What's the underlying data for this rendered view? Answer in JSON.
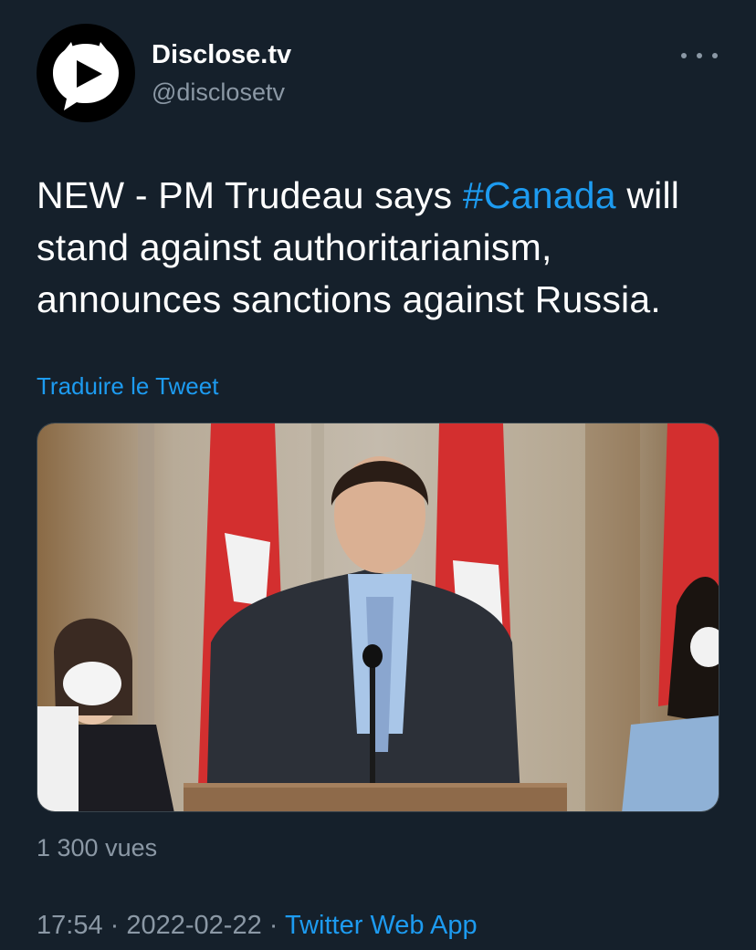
{
  "author": {
    "name": "Disclose.tv",
    "handle": "@disclosetv",
    "avatar_icon": "play-logo-icon"
  },
  "menu": {
    "icon": "more-options-icon"
  },
  "tweet": {
    "text_before": "NEW - PM Trudeau says ",
    "hashtag": "#Canada",
    "text_after": " will stand against authoritarianism, announces sanctions against Russia.",
    "translate_label": "Traduire le Tweet"
  },
  "stats": {
    "views": "1 300 vues"
  },
  "meta": {
    "time": "17:54",
    "separator": "·",
    "date": "2022-02-22",
    "source": "Twitter Web App"
  },
  "colors": {
    "background": "#15202b",
    "text": "#ffffff",
    "secondary": "#8b98a5",
    "accent": "#1d9bf0"
  }
}
